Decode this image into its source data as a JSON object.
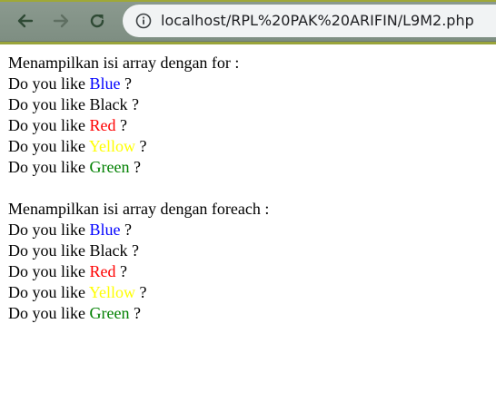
{
  "browser": {
    "url": "localhost/RPL%20PAK%20ARIFIN/L9M2.php"
  },
  "page": {
    "for_section": {
      "heading": "Menampilkan isi array dengan for :",
      "prefix": "Do you like",
      "suffix": "?",
      "colors": [
        {
          "name": "Blue",
          "color": "#0000ff"
        },
        {
          "name": "Black",
          "color": "#000000"
        },
        {
          "name": "Red",
          "color": "#ff0000"
        },
        {
          "name": "Yellow",
          "color": "#ffff00"
        },
        {
          "name": "Green",
          "color": "#008000"
        }
      ]
    },
    "foreach_section": {
      "heading": "Menampilkan isi array dengan foreach :",
      "prefix": "Do you like",
      "suffix": "?",
      "colors": [
        {
          "name": "Blue",
          "color": "#0000ff"
        },
        {
          "name": "Black",
          "color": "#000000"
        },
        {
          "name": "Red",
          "color": "#ff0000"
        },
        {
          "name": "Yellow",
          "color": "#ffff00"
        },
        {
          "name": "Green",
          "color": "#008000"
        }
      ]
    }
  },
  "icons": {
    "back": "arrow-left-icon",
    "forward": "arrow-right-icon",
    "reload": "reload-icon",
    "info": "info-icon"
  }
}
